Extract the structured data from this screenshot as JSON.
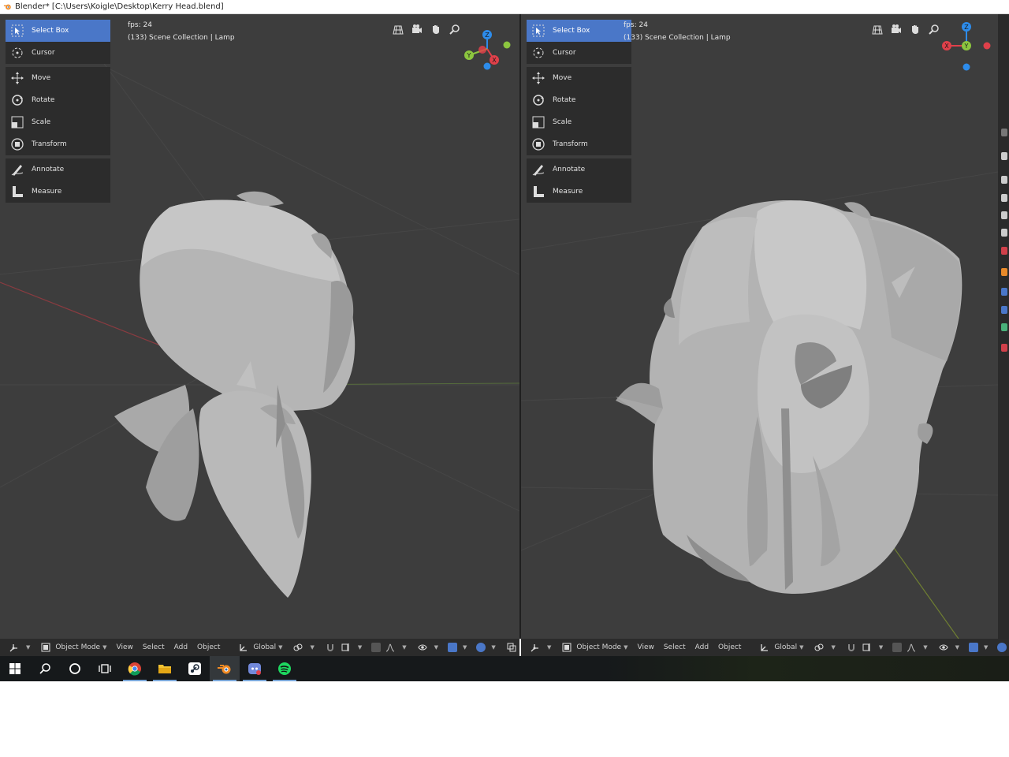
{
  "window": {
    "title": "Blender* [C:\\Users\\Koigle\\Desktop\\Kerry Head.blend]"
  },
  "tools": [
    {
      "label": "Select Box",
      "icon": "select-box-icon",
      "active": true
    },
    {
      "label": "Cursor",
      "icon": "cursor-icon"
    },
    {
      "label": "Move",
      "icon": "move-icon"
    },
    {
      "label": "Rotate",
      "icon": "rotate-icon"
    },
    {
      "label": "Scale",
      "icon": "scale-icon"
    },
    {
      "label": "Transform",
      "icon": "transform-icon"
    },
    {
      "label": "Annotate",
      "icon": "annotate-icon"
    },
    {
      "label": "Measure",
      "icon": "measure-icon"
    }
  ],
  "viewport_left": {
    "fps": "fps: 24",
    "collection": "(133) Scene Collection | Lamp"
  },
  "viewport_right": {
    "fps": "fps: 24",
    "collection": "(133) Scene Collection | Lamp"
  },
  "gizmo": {
    "x": "X",
    "y": "Y",
    "z": "Z"
  },
  "header": {
    "mode": "Object Mode",
    "menus": [
      "View",
      "Select",
      "Add",
      "Object"
    ],
    "orientation": "Global"
  },
  "taskbar": {
    "apps": [
      "windows-start-icon",
      "search-icon",
      "cortana-icon",
      "task-view-icon",
      "chrome-icon",
      "file-explorer-icon",
      "steam-icon",
      "blender-icon",
      "discord-icon",
      "spotify-icon"
    ]
  },
  "colors": {
    "viewport_bg": "#3d3d3d",
    "active_tool": "#4a77c8",
    "axis_x": "#e0404a",
    "axis_y": "#8cc63f",
    "axis_z": "#2d8ceb"
  }
}
